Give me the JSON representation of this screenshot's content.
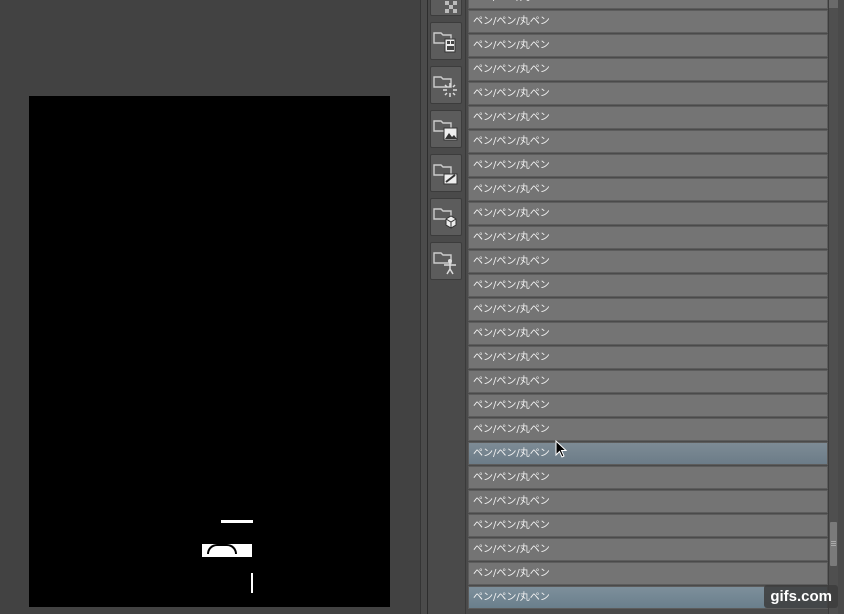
{
  "canvas": {
    "background_color": "#000000"
  },
  "icon_column": {
    "icons": [
      {
        "name": "transparency-folder-icon"
      },
      {
        "name": "pattern-folder-icon"
      },
      {
        "name": "effect-folder-icon"
      },
      {
        "name": "image-folder-icon"
      },
      {
        "name": "edit-folder-icon"
      },
      {
        "name": "3d-object-folder-icon"
      },
      {
        "name": "pose-folder-icon"
      }
    ]
  },
  "material_list": {
    "items": [
      {
        "label": "ペン/ペン/丸ペン",
        "state": "normal"
      },
      {
        "label": "ペン/ペン/丸ペン",
        "state": "normal"
      },
      {
        "label": "ペン/ペン/丸ペン",
        "state": "normal"
      },
      {
        "label": "ペン/ペン/丸ペン",
        "state": "normal"
      },
      {
        "label": "ペン/ペン/丸ペン",
        "state": "normal"
      },
      {
        "label": "ペン/ペン/丸ペン",
        "state": "normal"
      },
      {
        "label": "ペン/ペン/丸ペン",
        "state": "normal"
      },
      {
        "label": "ペン/ペン/丸ペン",
        "state": "normal"
      },
      {
        "label": "ペン/ペン/丸ペン",
        "state": "normal"
      },
      {
        "label": "ペン/ペン/丸ペン",
        "state": "normal"
      },
      {
        "label": "ペン/ペン/丸ペン",
        "state": "normal"
      },
      {
        "label": "ペン/ペン/丸ペン",
        "state": "normal"
      },
      {
        "label": "ペン/ペン/丸ペン",
        "state": "normal"
      },
      {
        "label": "ペン/ペン/丸ペン",
        "state": "normal"
      },
      {
        "label": "ペン/ペン/丸ペン",
        "state": "normal"
      },
      {
        "label": "ペン/ペン/丸ペン",
        "state": "normal"
      },
      {
        "label": "ペン/ペン/丸ペン",
        "state": "normal"
      },
      {
        "label": "ペン/ペン/丸ペン",
        "state": "normal"
      },
      {
        "label": "ペン/ペン/丸ペン",
        "state": "normal"
      },
      {
        "label": "ペン/ペン/丸ペン",
        "state": "hover"
      },
      {
        "label": "ペン/ペン/丸ペン",
        "state": "normal"
      },
      {
        "label": "ペン/ペン/丸ペン",
        "state": "normal"
      },
      {
        "label": "ペン/ペン/丸ペン",
        "state": "normal"
      },
      {
        "label": "ペン/ペン/丸ペン",
        "state": "normal"
      },
      {
        "label": "ペン/ペン/丸ペン",
        "state": "normal"
      },
      {
        "label": "ペン/ペン/丸ペン",
        "state": "selected"
      }
    ]
  },
  "watermark": {
    "text": "gifs.com"
  },
  "colors": {
    "panel_bg": "#4a4a4a",
    "item_bg": "#747474",
    "item_hover": "#7d8b95",
    "item_text": "#f2f2f2"
  }
}
